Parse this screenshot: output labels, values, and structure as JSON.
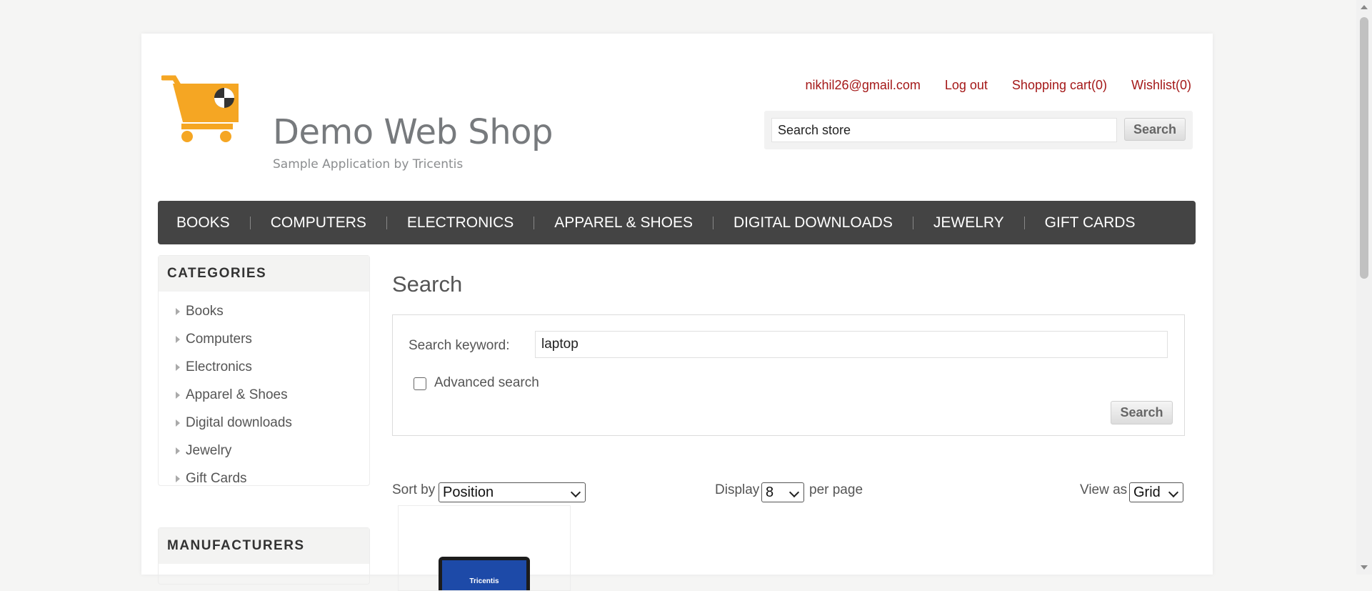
{
  "header": {
    "logo_title": "Demo Web Shop",
    "logo_subtitle": "Sample Application by Tricentis",
    "links": {
      "account": "nikhil26@gmail.com",
      "logout": "Log out",
      "cart": "Shopping cart(0)",
      "wishlist": "Wishlist(0)"
    },
    "search_value": "Search store",
    "search_button": "Search"
  },
  "nav": [
    "BOOKS",
    "COMPUTERS",
    "ELECTRONICS",
    "APPAREL & SHOES",
    "DIGITAL DOWNLOADS",
    "JEWELRY",
    "GIFT CARDS"
  ],
  "sidebar": {
    "categories_title": "CATEGORIES",
    "categories": [
      "Books",
      "Computers",
      "Electronics",
      "Apparel & Shoes",
      "Digital downloads",
      "Jewelry",
      "Gift Cards"
    ],
    "manufacturers_title": "MANUFACTURERS"
  },
  "main": {
    "title": "Search",
    "keyword_label": "Search keyword:",
    "keyword_value": "laptop",
    "advanced_label": "Advanced search",
    "advanced_checked": false,
    "search_button": "Search",
    "sort_label": "Sort by",
    "sort_value": "Position",
    "display_label": "Display",
    "display_value": "8",
    "per_page_label": "per page",
    "view_label": "View as",
    "view_value": "Grid"
  },
  "product": {
    "screen_brand": "Tricentis"
  },
  "colors": {
    "link": "#a41818",
    "nav_bg": "#444444",
    "logo_orange": "#f5a623"
  }
}
